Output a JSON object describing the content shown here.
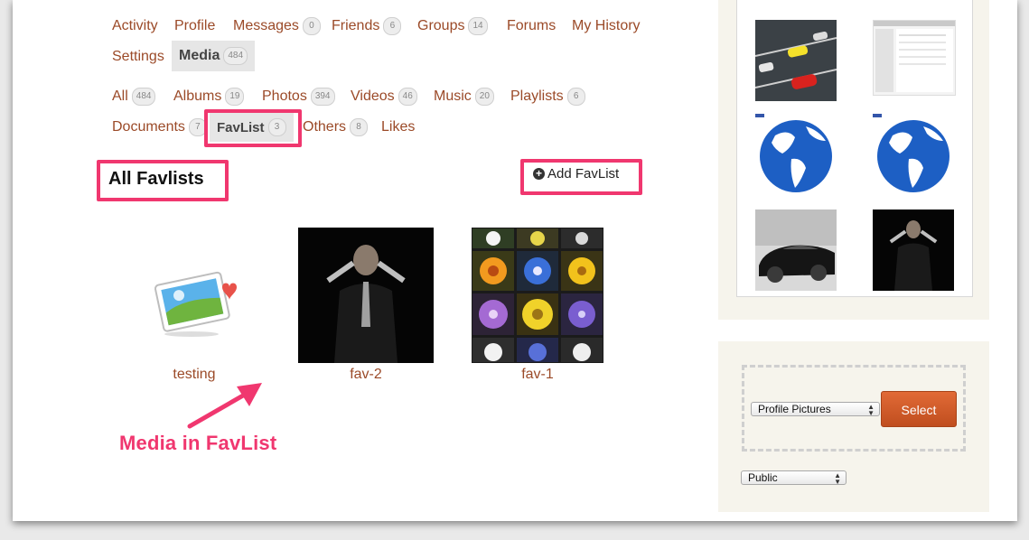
{
  "nav": {
    "row1": [
      {
        "label": "Activity",
        "badge": null
      },
      {
        "label": "Profile",
        "badge": null
      },
      {
        "label": "Messages",
        "badge": "0"
      },
      {
        "label": "Friends",
        "badge": "6"
      },
      {
        "label": "Groups",
        "badge": "14"
      },
      {
        "label": "Forums",
        "badge": null
      },
      {
        "label": "My History",
        "badge": null
      }
    ],
    "settings": "Settings",
    "media": {
      "label": "Media",
      "badge": "484"
    }
  },
  "subnav": {
    "row1": [
      {
        "label": "All",
        "badge": "484"
      },
      {
        "label": "Albums",
        "badge": "19"
      },
      {
        "label": "Photos",
        "badge": "394"
      },
      {
        "label": "Videos",
        "badge": "46"
      },
      {
        "label": "Music",
        "badge": "20"
      },
      {
        "label": "Playlists",
        "badge": "6"
      }
    ],
    "documents": {
      "label": "Documents",
      "badge": "7"
    },
    "favlist": {
      "label": "FavList",
      "badge": "3"
    },
    "others": {
      "label": "Others",
      "badge": "8"
    },
    "likes": "Likes"
  },
  "content": {
    "heading": "All Favlists",
    "add_button": "Add FavList",
    "items": [
      {
        "caption": "testing"
      },
      {
        "caption": "fav-2"
      },
      {
        "caption": "fav-1"
      }
    ],
    "annotation": "Media in FavList"
  },
  "sidebar": {
    "upload": {
      "album_select": "Profile Pictures",
      "select_button": "Select",
      "privacy_select": "Public"
    }
  },
  "colors": {
    "link": "#9b4a28",
    "highlight": "#f0376f",
    "button": "#d95f2b",
    "sidebar_bg": "#f6f4ec"
  }
}
